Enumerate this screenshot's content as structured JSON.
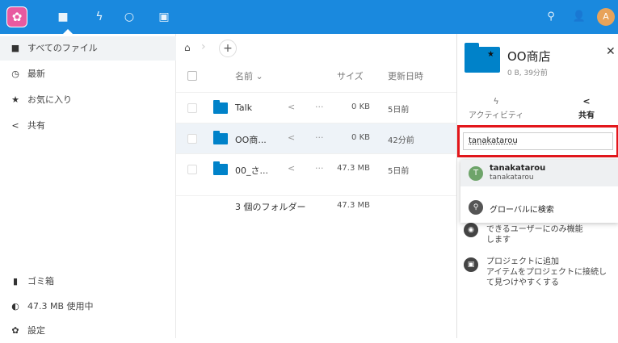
{
  "topbar": {
    "apps": [
      "files-icon",
      "activity-icon",
      "search-icon",
      "calendar-icon"
    ],
    "avatar_initial": "A"
  },
  "sidebar": {
    "items": [
      {
        "label": "すべてのファイル",
        "icon": "folder-icon"
      },
      {
        "label": "最新",
        "icon": "clock-icon"
      },
      {
        "label": "お気に入り",
        "icon": "star-icon"
      },
      {
        "label": "共有",
        "icon": "share-icon"
      }
    ],
    "bottom": [
      {
        "label": "ゴミ箱",
        "icon": "trash-icon"
      },
      {
        "label": "47.3 MB 使用中",
        "icon": "quota-icon"
      },
      {
        "label": "設定",
        "icon": "gear-icon"
      }
    ]
  },
  "files": {
    "headers": {
      "name": "名前",
      "size": "サイズ",
      "date": "更新日時"
    },
    "rows": [
      {
        "name": "Talk",
        "size": "0 KB",
        "date": "5日前"
      },
      {
        "name": "OO商...",
        "size": "0 KB",
        "date": "42分前"
      },
      {
        "name": "00_さ...",
        "size": "47.3 MB",
        "date": "5日前"
      }
    ],
    "summary": {
      "count": "3 個のフォルダー",
      "size": "47.3 MB"
    }
  },
  "panel": {
    "title": "OO商店",
    "subtitle": "0 B, 39分前",
    "tabs": [
      {
        "label": "アクティビティ",
        "icon": "activity-icon"
      },
      {
        "label": "共有",
        "icon": "share-icon"
      }
    ],
    "search_value": "tanakatarou",
    "suggestion": {
      "initial": "T",
      "name": "tanakatarou",
      "sub": "tanakatarou"
    },
    "global_search": "グローバルに検索",
    "info1": {
      "line1": "できるユーザーにのみ機能",
      "line2": "します"
    },
    "project": {
      "title": "プロジェクトに追加",
      "line1": "アイテムをプロジェクトに接続し",
      "line2": "て見つけやすくする"
    }
  },
  "colors": {
    "topbar": "#1a89de",
    "folder": "#0082c9",
    "highlight": "#e3161b"
  }
}
